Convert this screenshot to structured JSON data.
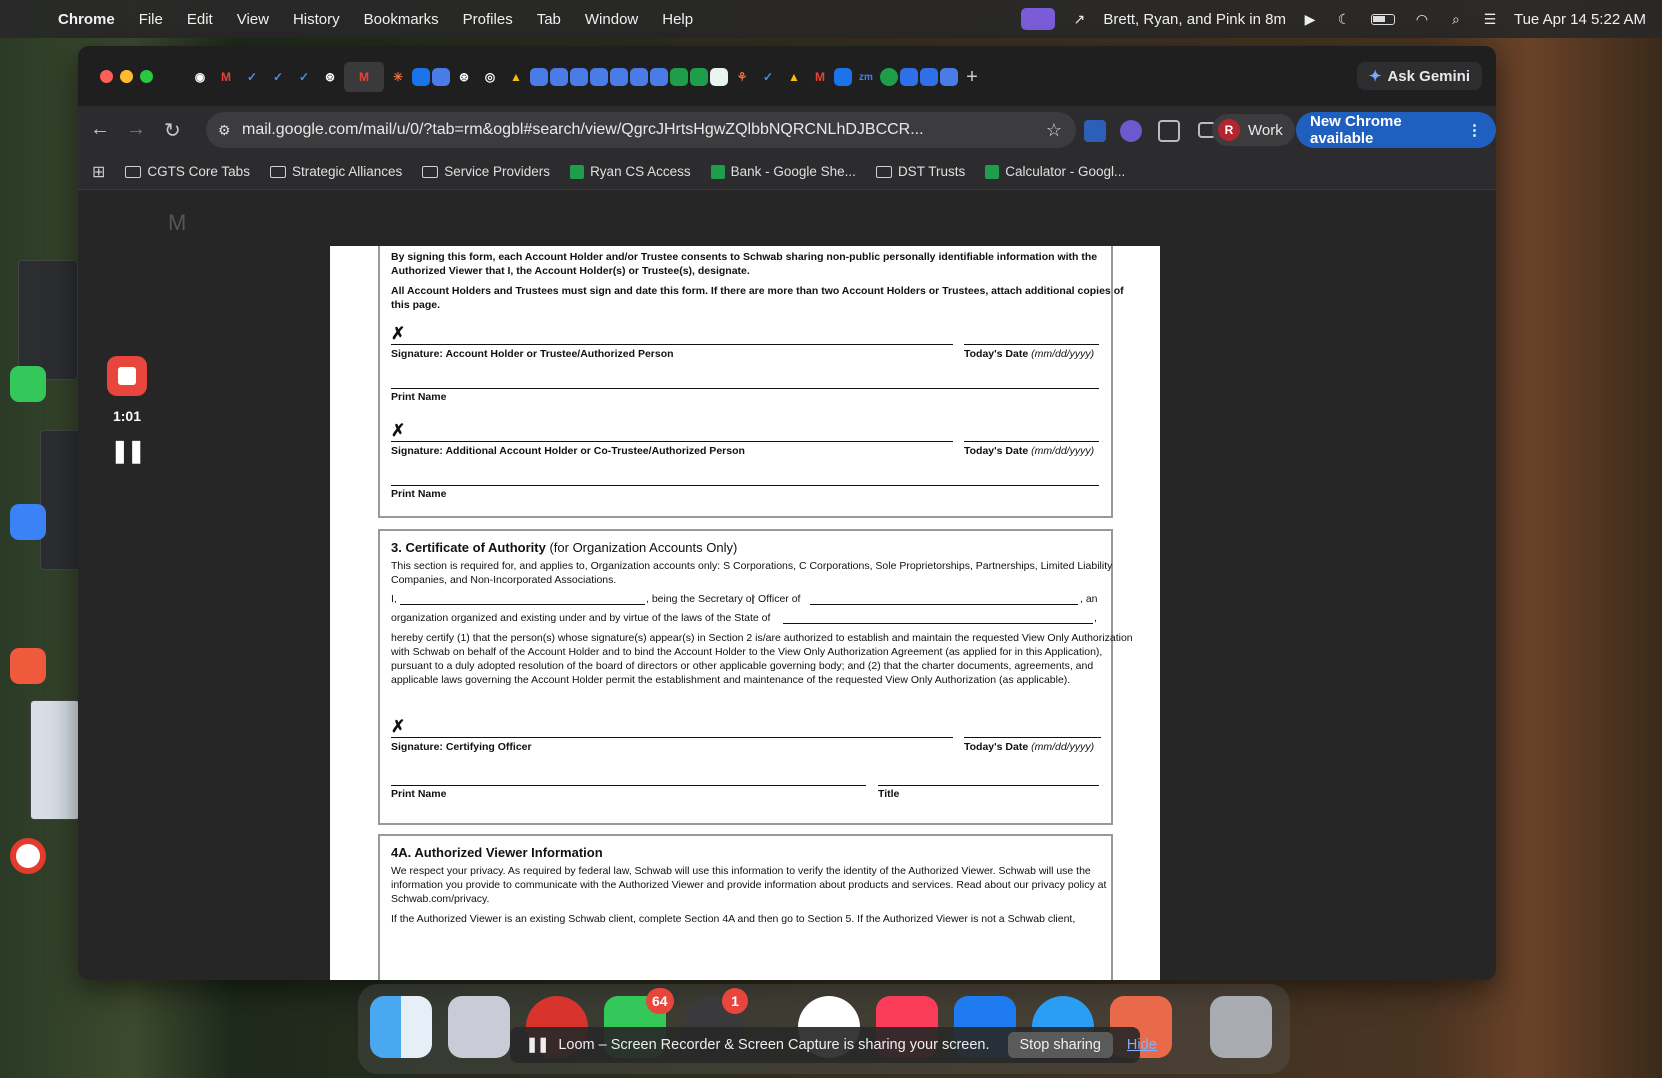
{
  "menubar": {
    "app": "Chrome",
    "items": [
      "File",
      "Edit",
      "View",
      "History",
      "Bookmarks",
      "Profiles",
      "Tab",
      "Window",
      "Help"
    ],
    "meeting": "Brett, Ryan, and Pink in 8m",
    "datetime": "Tue Apr 14  5:22 AM"
  },
  "loom": {
    "timer": "1:01",
    "bar_message": "Loom – Screen Recorder & Screen Capture is sharing your screen.",
    "stop_label": "Stop sharing",
    "hide_label": "Hide"
  },
  "browser": {
    "url": "mail.google.com/mail/u/0/?tab=rm&ogbl#search/view/QgrcJHrtsHgwZQlbbNQRCNLhDJBCCR...",
    "ask_gemini": "Ask Gemini",
    "profile_label": "Work",
    "profile_initial": "R",
    "new_chrome": "New Chrome available",
    "bookmarks": [
      {
        "label": "CGTS Core Tabs",
        "type": "folder"
      },
      {
        "label": "Strategic Alliances",
        "type": "folder"
      },
      {
        "label": "Service Providers",
        "type": "folder"
      },
      {
        "label": "Ryan CS Access",
        "type": "sheet"
      },
      {
        "label": "Bank - Google She...",
        "type": "sheet"
      },
      {
        "label": "DST Trusts",
        "type": "folder"
      },
      {
        "label": "Calculator - Googl...",
        "type": "sheet"
      }
    ]
  },
  "document": {
    "consent_text": "By signing this form, each Account Holder and/or Trustee consents to Schwab sharing non-public personally identifiable information with the Authorized Viewer that I, the Account Holder(s) or Trustee(s), designate.",
    "sign_instruction": "All Account Holders and Trustees must sign and date this form. If there are more than two Account Holders or Trustees, attach additional copies of this page.",
    "x_mark": "✗",
    "sig1_label": "Signature: Account Holder or Trustee/Authorized Person",
    "date_label": "Today's Date",
    "date_format": "(mm/dd/yyyy)",
    "print_name": "Print Name",
    "sig2_label": "Signature: Additional Account Holder or Co-Trustee/Authorized Person",
    "section3_title": "3. Certificate of Authority",
    "section3_sub": "(for Organization Accounts Only)",
    "section3_intro": "This section is required for, and applies to, Organization accounts only: S Corporations, C Corporations, Sole Proprietorships, Partnerships, Limited Liability Companies, and Non-Incorporated Associations.",
    "cert_i": "I,",
    "cert_being": ", being the Secretary or Officer of",
    "cert_an": ", an",
    "cert_org": "organization organized and existing under and by virtue of the laws of the State of",
    "cert_comma": ",",
    "cert_body": "hereby certify (1) that the person(s) whose signature(s) appear(s) in Section 2 is/are authorized to establish and maintain the requested View Only Authorization with Schwab on behalf of the Account Holder and to bind the Account Holder to the View Only Authorization Agreement (as applied for in this Application), pursuant to a duly adopted resolution of the board of directors or other applicable governing body; and (2) that the charter documents, agreements, and applicable laws governing the Account Holder permit the establishment and maintenance of the requested View Only Authorization (as applicable).",
    "sig3_label": "Signature: Certifying Officer",
    "title_label": "Title",
    "section4_title": "4A. Authorized Viewer Information",
    "section4_intro": "We respect your privacy. As required by federal law, Schwab will use this information to verify the identity of the Authorized Viewer. Schwab will use the information you provide to communicate with the Authorized Viewer and provide information about products and services. Read about our privacy policy at Schwab.com/privacy.",
    "section4_next": "If the Authorized Viewer is an existing Schwab client, complete Section 4A and then go to Section 5. If the Authorized Viewer is not a Schwab client,"
  },
  "dock": {
    "messages_badge": "64",
    "settings_badge": "1"
  }
}
